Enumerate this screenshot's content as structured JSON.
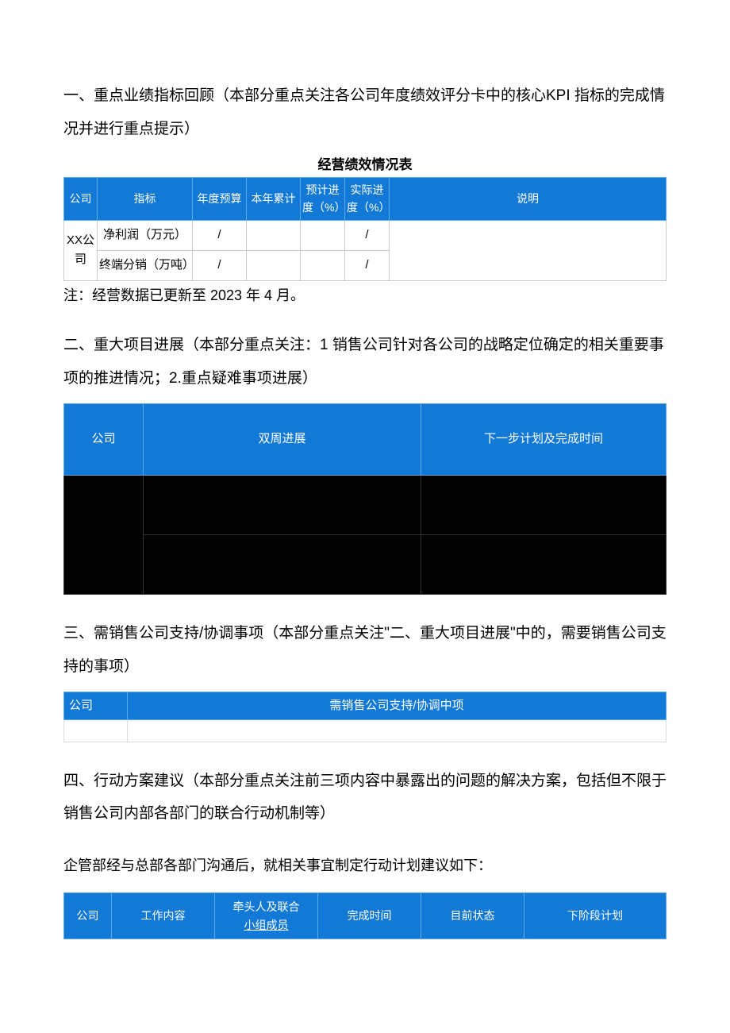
{
  "section1": {
    "title": "一、重点业绩指标回顾（本部分重点关注各公司年度绩效评分卡中的核心KPI 指标的完成情况并进行重点提示）",
    "table_caption": "经营绩效情况表",
    "headers": {
      "company": "公司",
      "indicator": "指标",
      "annual_budget": "年度预算",
      "ytd": "本年累计",
      "expected_progress": "预计进度（%）",
      "actual_progress": "实际进度（%）",
      "description": "说明"
    },
    "rows": [
      {
        "company": "XX公司",
        "indicator": "净利润（万元）",
        "annual_budget": "/",
        "ytd": "",
        "expected_progress": "",
        "actual_progress": "/",
        "description": ""
      },
      {
        "company": "",
        "indicator": "终端分销（万吨）",
        "annual_budget": "/",
        "ytd": "",
        "expected_progress": "",
        "actual_progress": "/",
        "description": ""
      }
    ],
    "note": "注：经营数据已更新至 2023 年 4 月。"
  },
  "section2": {
    "title": "二、重大项目进展（本部分重点关注：1 销售公司针对各公司的战略定位确定的相关重要事项的推进情况；2.重点疑难事项进展）",
    "headers": {
      "company": "公司",
      "biweekly_progress": "双周进展",
      "next_plan": "下一步计划及完成时间"
    },
    "rows": [
      {
        "company": "",
        "biweekly_progress": "",
        "next_plan": ""
      },
      {
        "company": "",
        "biweekly_progress": "",
        "next_plan": ""
      }
    ]
  },
  "section3": {
    "title": "三、需销售公司支持/协调事项（本部分重点关注\"二、重大项目进展\"中的，需要销售公司支持的事项）",
    "headers": {
      "company": "公司",
      "support_item": "需销售公司支持/协调中项"
    },
    "rows": [
      {
        "company": "",
        "support_item": ""
      }
    ]
  },
  "section4": {
    "title": "四、行动方案建议（本部分重点关注前三项内容中暴露出的问题的解决方案，包括但不限于销售公司内部各部门的联合行动机制等）",
    "body_text": "企管部经与总部各部门沟通后，就相关事宜制定行动计划建议如下：",
    "headers": {
      "company": "公司",
      "work_content": "工作内容",
      "lead_prefix": "牵头人及联合",
      "lead_suffix": "小组成员",
      "completion_time": "完成时间",
      "current_status": "目前状态",
      "next_stage_plan": "下阶段计划"
    }
  }
}
